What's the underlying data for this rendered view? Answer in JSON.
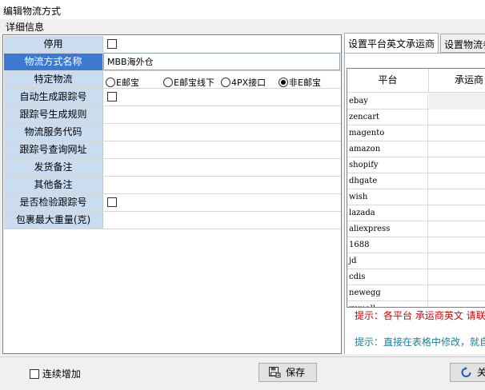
{
  "window": {
    "title": "编辑物流方式"
  },
  "tab_header": "详细信息",
  "form": {
    "rows": [
      {
        "label": "停用"
      },
      {
        "label": "物流方式名称",
        "value": "MBB海外仓"
      },
      {
        "label": "特定物流"
      },
      {
        "label": "自动生成跟踪号"
      },
      {
        "label": "跟踪号生成规则",
        "value": ""
      },
      {
        "label": "物流服务代码",
        "value": ""
      },
      {
        "label": "跟踪号查询网址",
        "value": ""
      },
      {
        "label": "发货备注",
        "value": ""
      },
      {
        "label": "其他备注",
        "value": ""
      },
      {
        "label": "是否检验跟踪号"
      },
      {
        "label": "包裹最大重量(克)",
        "value": ""
      }
    ],
    "radio_options": [
      {
        "label": "E邮宝",
        "selected": false
      },
      {
        "label": "E邮宝线下",
        "selected": false
      },
      {
        "label": "4PX接口",
        "selected": false
      },
      {
        "label": "非E邮宝",
        "selected": true
      }
    ]
  },
  "right_tabs": [
    {
      "label": "设置平台英文承运商"
    },
    {
      "label": "设置物流参"
    }
  ],
  "grid": {
    "headers": [
      "平台",
      "承运商"
    ],
    "rows": [
      "ebay",
      "zencart",
      "magento",
      "amazon",
      "shopify",
      "dhgate",
      "wish",
      "lazada",
      "aliexpress",
      "1688",
      "jd",
      "cdis",
      "newegg",
      "rumall"
    ]
  },
  "tips": {
    "tip1": "提示：各平台 承运商英文 请联",
    "tip2": "提示：直接在表格中修改，就自"
  },
  "footer": {
    "continuous_add": "连续增加",
    "save": "保存",
    "close": "关闭"
  },
  "colors": {
    "label_bg": "#c9dcf0",
    "label_selected_bg": "#3b79d3",
    "tip_red": "#d40000",
    "tip_teal": "#1f7fa0"
  }
}
